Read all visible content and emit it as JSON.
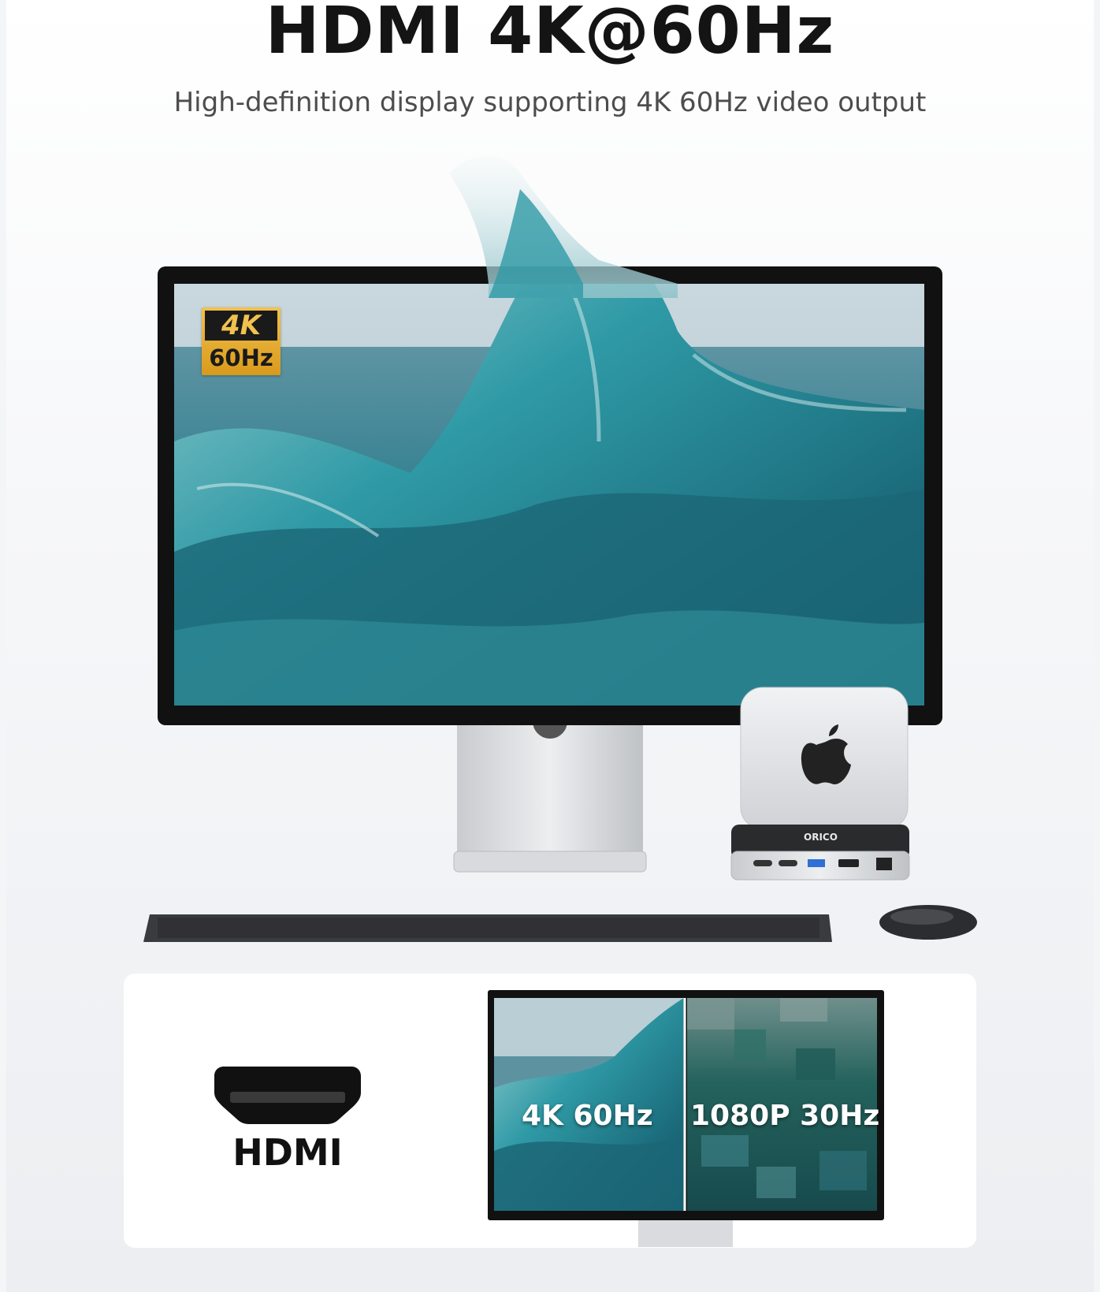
{
  "header": {
    "title": "HDMI 4K@60Hz",
    "subtitle": "High-definition display supporting 4K 60Hz video output"
  },
  "monitor": {
    "badge_top": "4K",
    "badge_bottom": "60Hz"
  },
  "dock": {
    "brand": "ORICO"
  },
  "comparison": {
    "port_label": "HDMI",
    "left_label": "4K 60Hz",
    "right_label": "1080P 30Hz"
  },
  "colors": {
    "accent_gold": "#e9b23a",
    "wave_teal": "#1f7d8f",
    "ink": "#141414"
  }
}
